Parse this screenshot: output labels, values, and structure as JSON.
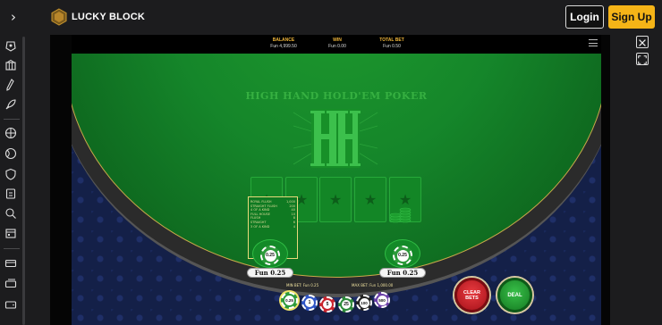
{
  "header": {
    "brand": "LUCKY BLOCK",
    "login_label": "Login",
    "signup_label": "Sign Up"
  },
  "sidebar": {
    "items": [
      {
        "icon": "casino-icon"
      },
      {
        "icon": "slots-icon"
      },
      {
        "icon": "live-casino-icon"
      },
      {
        "icon": "rocket-icon"
      },
      {
        "icon": "basketball-icon"
      },
      {
        "icon": "tennis-icon"
      },
      {
        "icon": "shield-icon"
      },
      {
        "icon": "esports-icon"
      },
      {
        "icon": "search-icon"
      },
      {
        "icon": "calendar-icon"
      },
      {
        "icon": "card-icon"
      },
      {
        "icon": "tickets-icon"
      },
      {
        "icon": "wallet-icon"
      }
    ]
  },
  "game": {
    "stats": {
      "balance_label": "BALANCE",
      "balance_value": "Fun 4,999.50",
      "win_label": "WIN",
      "win_value": "Fun 0.00",
      "total_bet_label": "TOTAL BET",
      "total_bet_value": "Fun 0.50"
    },
    "title": "HIGH HAND HOLD'EM POKER",
    "paytable": [
      {
        "hand": "ROYAL FLUSH",
        "pays": "1,000"
      },
      {
        "hand": "STRAIGHT FLUSH",
        "pays": "200"
      },
      {
        "hand": "4 OF A KIND",
        "pays": "40"
      },
      {
        "hand": "FULL HOUSE",
        "pays": "10"
      },
      {
        "hand": "FLUSH",
        "pays": "8"
      },
      {
        "hand": "STRAIGHT",
        "pays": "6"
      },
      {
        "hand": "3 OF A KIND",
        "pays": "4"
      }
    ],
    "left_bet": {
      "chip": "0.25",
      "amount": "Fun 0.25"
    },
    "right_bet": {
      "chip": "0.25",
      "amount": "Fun 0.25"
    },
    "min_bet": "MIN BET: Fun 0.25",
    "max_bet": "MAX BET: Fun 1,000.00",
    "chips": [
      {
        "value": "0.25",
        "color": "#2c9a3a",
        "selected": true
      },
      {
        "value": "1",
        "color": "#2f55c5",
        "selected": false
      },
      {
        "value": "5",
        "color": "#c8232c",
        "selected": false
      },
      {
        "value": "25",
        "color": "#2c8a3a",
        "selected": false
      },
      {
        "value": "100",
        "color": "#222222",
        "selected": false
      },
      {
        "value": "500",
        "color": "#6a3ea8",
        "selected": false
      }
    ],
    "clear_bets_label": "CLEAR BETS",
    "deal_label": "DEAL"
  },
  "colors": {
    "accent": "#f5b417",
    "felt": "#15862a",
    "clear_button": "#d0202a",
    "deal_button": "#1e9a2e"
  }
}
